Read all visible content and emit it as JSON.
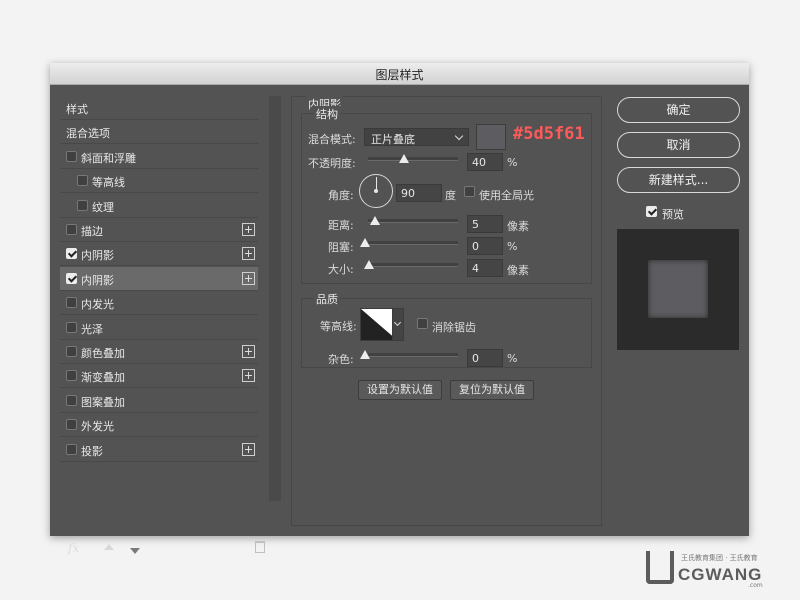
{
  "window": {
    "title": "图层样式"
  },
  "styles_list": [
    {
      "label": "样式",
      "checkbox": false,
      "checked": false,
      "plus": false,
      "indent": 0,
      "selected": false
    },
    {
      "label": "混合选项",
      "checkbox": false,
      "checked": false,
      "plus": false,
      "indent": 0,
      "selected": false
    },
    {
      "label": "斜面和浮雕",
      "checkbox": true,
      "checked": false,
      "plus": false,
      "indent": 0,
      "selected": false
    },
    {
      "label": "等高线",
      "checkbox": true,
      "checked": false,
      "plus": false,
      "indent": 1,
      "selected": false
    },
    {
      "label": "纹理",
      "checkbox": true,
      "checked": false,
      "plus": false,
      "indent": 1,
      "selected": false
    },
    {
      "label": "描边",
      "checkbox": true,
      "checked": false,
      "plus": true,
      "indent": 0,
      "selected": false
    },
    {
      "label": "内阴影",
      "checkbox": true,
      "checked": true,
      "plus": true,
      "indent": 0,
      "selected": false
    },
    {
      "label": "内阴影",
      "checkbox": true,
      "checked": true,
      "plus": true,
      "indent": 0,
      "selected": true
    },
    {
      "label": "内发光",
      "checkbox": true,
      "checked": false,
      "plus": false,
      "indent": 0,
      "selected": false
    },
    {
      "label": "光泽",
      "checkbox": true,
      "checked": false,
      "plus": false,
      "indent": 0,
      "selected": false
    },
    {
      "label": "颜色叠加",
      "checkbox": true,
      "checked": false,
      "plus": true,
      "indent": 0,
      "selected": false
    },
    {
      "label": "渐变叠加",
      "checkbox": true,
      "checked": false,
      "plus": true,
      "indent": 0,
      "selected": false
    },
    {
      "label": "图案叠加",
      "checkbox": true,
      "checked": false,
      "plus": false,
      "indent": 0,
      "selected": false
    },
    {
      "label": "外发光",
      "checkbox": true,
      "checked": false,
      "plus": false,
      "indent": 0,
      "selected": false
    },
    {
      "label": "投影",
      "checkbox": true,
      "checked": false,
      "plus": true,
      "indent": 0,
      "selected": false
    }
  ],
  "left_footer": {
    "fx_label": "fx",
    "icons": [
      "move-up-icon",
      "move-down-icon",
      "trash-icon"
    ]
  },
  "panel": {
    "title": "内阴影",
    "structure": {
      "title": "结构",
      "blend_mode_label": "混合模式:",
      "blend_mode_value": "正片叠底",
      "color_hex_annotation": "#5d5f61",
      "swatch_color": "#5d5d61",
      "opacity_label": "不透明度:",
      "opacity_value": "40",
      "opacity_unit": "%",
      "opacity_fraction": 0.4,
      "angle_label": "角度:",
      "angle_value": "90",
      "angle_unit": "度",
      "global_light_label": "使用全局光",
      "global_light_checked": false,
      "distance_label": "距离:",
      "distance_value": "5",
      "distance_unit": "像素",
      "choke_label": "阻塞:",
      "choke_value": "0",
      "choke_unit": "%",
      "size_label": "大小:",
      "size_value": "4",
      "size_unit": "像素"
    },
    "quality": {
      "title": "品质",
      "contour_label": "等高线:",
      "anti_alias_label": "消除锯齿",
      "anti_alias_checked": false,
      "noise_label": "杂色:",
      "noise_value": "0",
      "noise_unit": "%"
    },
    "buttons": {
      "set_default": "设置为默认值",
      "reset_default": "复位为默认值"
    }
  },
  "right": {
    "ok": "确定",
    "cancel": "取消",
    "new_style": "新建样式...",
    "preview_label": "预览",
    "preview_checked": true,
    "preview_fill": "#5d5d61"
  },
  "watermark": {
    "brand": "CGWANG",
    "tagline": "王氏教育集团 · 王氏教育",
    "domain": ".com"
  }
}
